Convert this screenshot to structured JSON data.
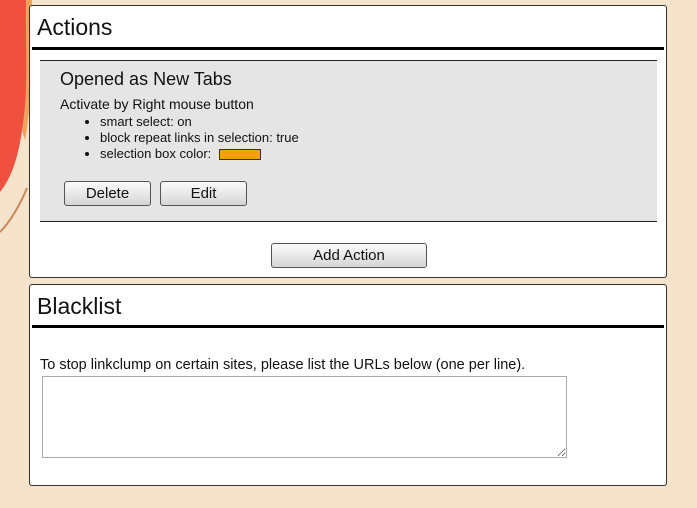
{
  "theme": {
    "background": "#f5e3cb",
    "panel_bg": "#ffffff",
    "card_bg": "#e5e5e5",
    "selection_color": "#f5a000",
    "deco_red": "#f0503f",
    "deco_orange": "#f2a35a"
  },
  "actions": {
    "title": "Actions",
    "items": [
      {
        "title": "Opened as New Tabs",
        "activate": "Activate by Right mouse button",
        "options": {
          "smart_select": "smart select: on",
          "block_repeat": "block repeat links in selection: true",
          "selection_box_color": "selection box color:"
        },
        "delete_label": "Delete",
        "edit_label": "Edit"
      }
    ],
    "add_label": "Add Action"
  },
  "blacklist": {
    "title": "Blacklist",
    "help_text": "To stop linkclump on certain sites, please list the URLs below (one per line).",
    "urls": ""
  }
}
